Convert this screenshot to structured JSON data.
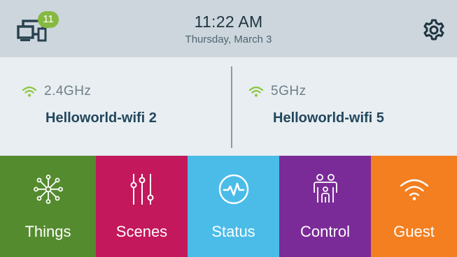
{
  "header": {
    "device_badge_count": "11",
    "time": "11:22 AM",
    "date": "Thursday, March 3",
    "devices_icon": "devices-icon",
    "settings_icon": "gear-icon"
  },
  "networks": [
    {
      "band": "2.4GHz",
      "ssid": "Helloworld-wifi 2",
      "icon": "wifi-icon"
    },
    {
      "band": "5GHz",
      "ssid": "Helloworld-wifi 5",
      "icon": "wifi-icon"
    }
  ],
  "tiles": [
    {
      "label": "Things",
      "icon": "hub-network-icon",
      "color": "#558b2f"
    },
    {
      "label": "Scenes",
      "icon": "sliders-icon",
      "color": "#c3185b"
    },
    {
      "label": "Status",
      "icon": "pulse-icon",
      "color": "#4bbce8"
    },
    {
      "label": "Control",
      "icon": "family-icon",
      "color": "#7b2b98"
    },
    {
      "label": "Guest",
      "icon": "wifi-icon",
      "color": "#f37f20"
    }
  ],
  "colors": {
    "header_bg": "#ccd6dc",
    "networks_bg": "#e8eef1",
    "badge": "#86b942",
    "wifi_accent": "#8cc63f",
    "ssid_text": "#23475d"
  }
}
